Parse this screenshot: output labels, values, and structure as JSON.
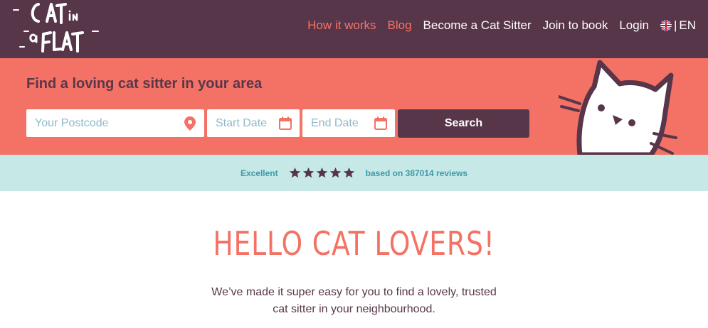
{
  "brand": {
    "logo_text": "Cat in a Flat"
  },
  "nav": {
    "items": [
      {
        "label": "How it works"
      },
      {
        "label": "Blog"
      },
      {
        "label": "Become a Cat Sitter"
      },
      {
        "label": "Join to book"
      },
      {
        "label": "Login"
      }
    ],
    "language": {
      "separator": "|",
      "code": "EN",
      "flag_icon": "uk-flag-icon"
    }
  },
  "search": {
    "heading": "Find a loving cat sitter in your area",
    "postcode_placeholder": "Your Postcode",
    "start_placeholder": "Start Date",
    "end_placeholder": "End Date",
    "button_label": "Search",
    "icons": {
      "postcode": "location-pin-icon",
      "start": "calendar-icon",
      "end": "calendar-icon"
    }
  },
  "reviews": {
    "rating_label": "Excellent",
    "stars": 5,
    "count_text": "based on 387014 reviews"
  },
  "hero": {
    "title": "HELLO CAT LOVERS!",
    "line1": "We’ve made it super easy for you to find a lovely, trusted",
    "line2": "cat sitter in your neighbourhood."
  },
  "colors": {
    "plum": "#58364a",
    "coral": "#f47265",
    "mint": "#c6e8e6",
    "teal_text": "#3f9aa8",
    "placeholder": "#8fb9cc"
  }
}
